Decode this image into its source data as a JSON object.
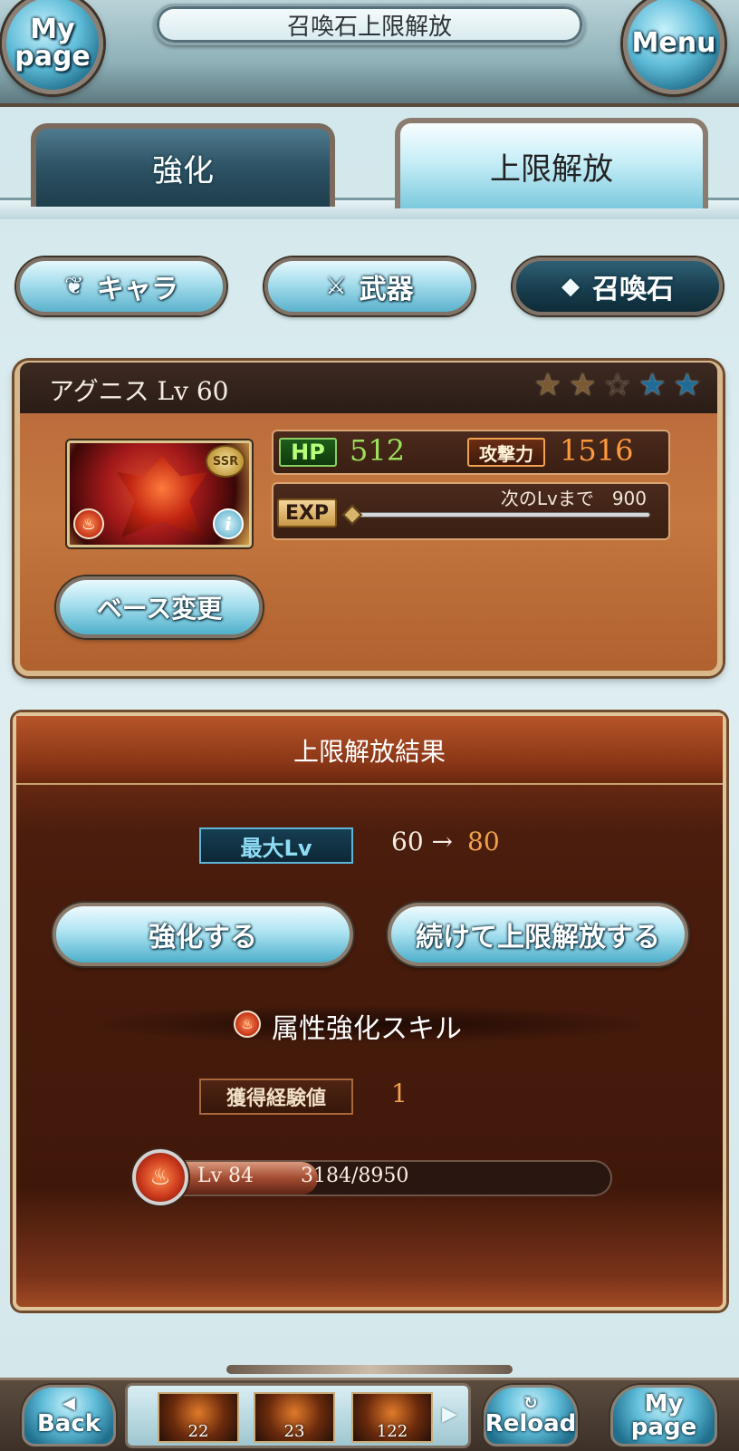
{
  "header": {
    "title": "召喚石上限解放",
    "mypage_line1": "My",
    "mypage_line2": "page",
    "menu_label": "Menu"
  },
  "tabs": [
    {
      "label": "強化",
      "active": false
    },
    {
      "label": "上限解放",
      "active": true
    }
  ],
  "categories": [
    {
      "label": "キャラ",
      "icon": "chara-icon",
      "active": false
    },
    {
      "label": "武器",
      "icon": "weapon-icon",
      "active": false
    },
    {
      "label": "召喚石",
      "icon": "crystal-icon",
      "active": true
    }
  ],
  "summon": {
    "name_level": "アグニス Lv 60",
    "rarity": "SSR",
    "stars_filled": 2,
    "stars_total": 5,
    "hp_label": "HP",
    "hp": "512",
    "atk_label": "攻撃力",
    "atk": "1516",
    "exp_label": "EXP",
    "exp_next": "次のLvまで　900",
    "exp_progress": 0,
    "base_change_label": "ベース変更"
  },
  "result": {
    "title": "上限解放結果",
    "max_lv_label": "最大Lv",
    "max_lv_from": "60 →",
    "max_lv_to": "80",
    "enhance_button": "強化する",
    "continue_button": "続けて上限解放する",
    "skill_name": "属性強化スキル",
    "gain_exp_label": "獲得経験値",
    "gain_exp_value": "1",
    "skill_level": "Lv 84",
    "skill_progress": "3184/8950",
    "skill_fill_fraction": 0.356
  },
  "footer": {
    "back_label": "Back",
    "reload_label": "Reload",
    "mypage_line1": "My",
    "mypage_line2": "page",
    "shortcuts": [
      "22",
      "23",
      "122"
    ]
  },
  "colors": {
    "accent_blue": "#5fbcd8",
    "panel_brown": "#b9683c",
    "hp_green": "#9be05a",
    "atk_orange": "#ff9a3c"
  }
}
